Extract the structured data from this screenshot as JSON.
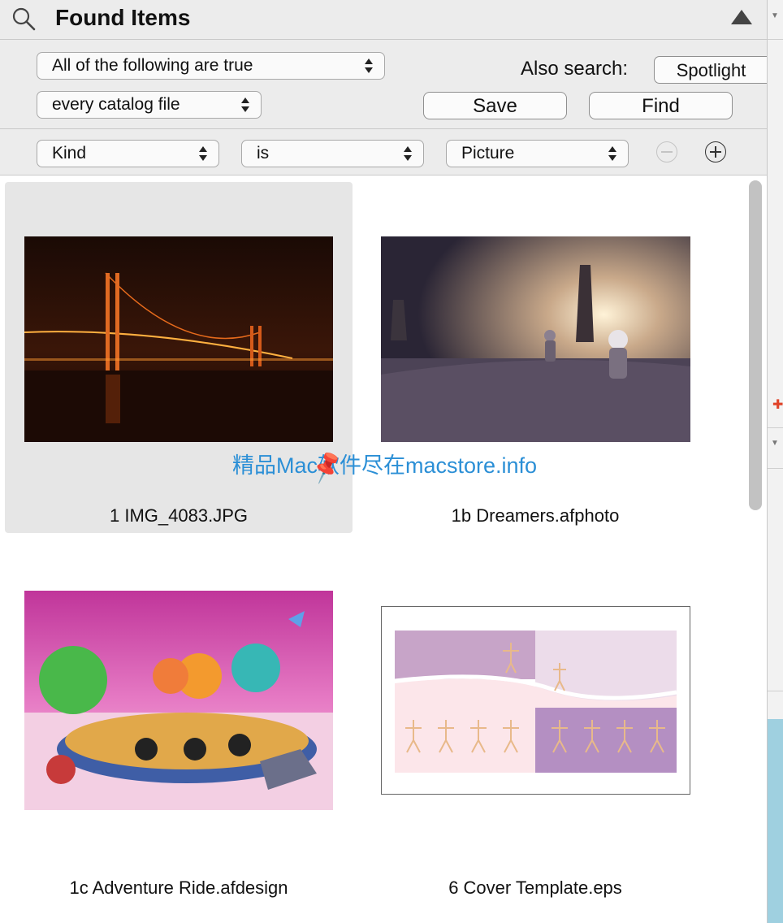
{
  "panel": {
    "title": "Found Items"
  },
  "criteria": {
    "match_mode": "All of the following are true",
    "scope": "every catalog file",
    "also_search_label": "Also search:",
    "spotlight_label": "Spotlight",
    "save_label": "Save",
    "find_label": "Find"
  },
  "rule": {
    "field": "Kind",
    "operator": "is",
    "value": "Picture"
  },
  "results": [
    {
      "name": "1 IMG_4083.JPG",
      "selected": true
    },
    {
      "name": "1b Dreamers.afphoto",
      "selected": false
    },
    {
      "name": "1c Adventure Ride.afdesign",
      "selected": false
    },
    {
      "name": "6 Cover Template.eps",
      "selected": false
    }
  ],
  "watermark": "精品Mac软件尽在macstore.info",
  "colors": {
    "selection": "#e6e6e6",
    "watermark": "#2b8fd6",
    "background": "#ececec"
  }
}
